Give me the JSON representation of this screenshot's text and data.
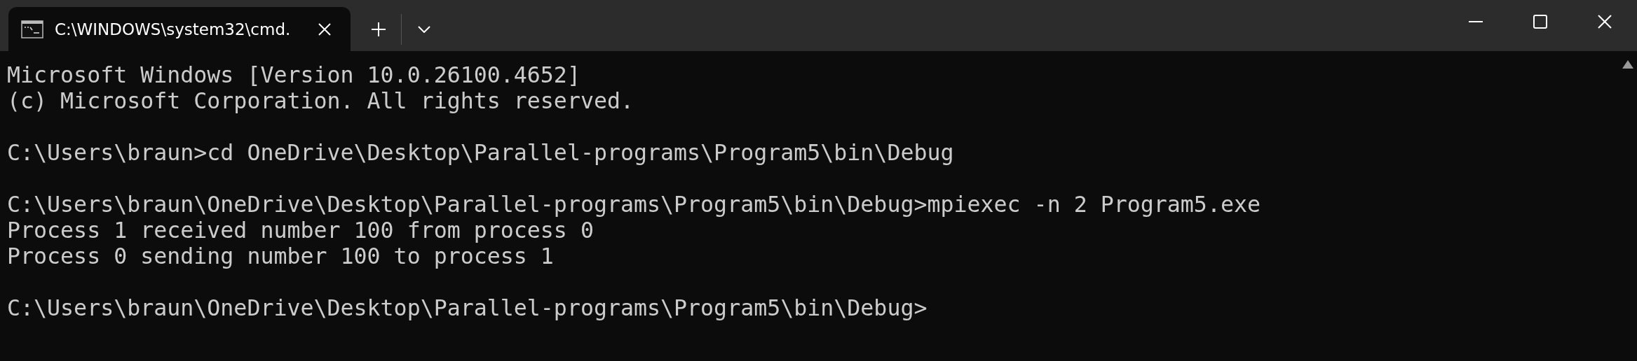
{
  "tabs": [
    {
      "title": "C:\\WINDOWS\\system32\\cmd.",
      "selected": true
    }
  ],
  "console": {
    "blocks": [
      [
        "Microsoft Windows [Version 10.0.26100.4652]",
        "(c) Microsoft Corporation. All rights reserved."
      ],
      [
        "C:\\Users\\braun>cd OneDrive\\Desktop\\Parallel-programs\\Program5\\bin\\Debug"
      ],
      [
        "C:\\Users\\braun\\OneDrive\\Desktop\\Parallel-programs\\Program5\\bin\\Debug>mpiexec -n 2 Program5.exe",
        "Process 1 received number 100 from process 0",
        "Process 0 sending number 100 to process 1"
      ],
      [
        "C:\\Users\\braun\\OneDrive\\Desktop\\Parallel-programs\\Program5\\bin\\Debug>"
      ]
    ]
  }
}
